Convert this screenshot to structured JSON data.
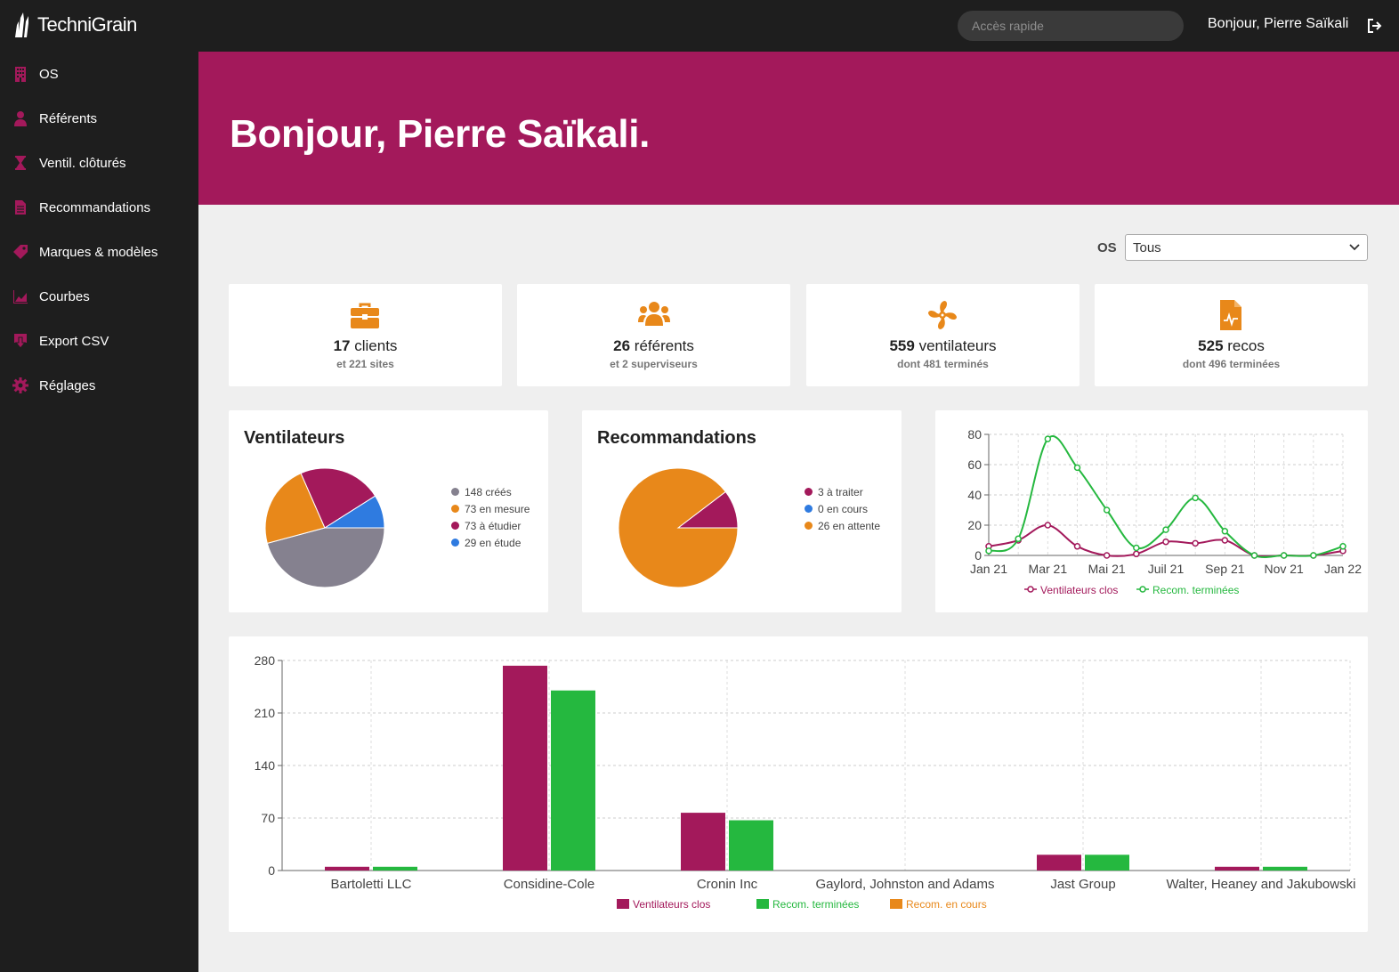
{
  "app": {
    "brand": "TechniGrain",
    "search_placeholder": "Accès rapide",
    "greeting": "Bonjour, Pierre Saïkali",
    "colors": {
      "accent": "#a3195b",
      "icon": "#e8881a",
      "green": "#25b83f",
      "sidebar": "#1e1e1e"
    }
  },
  "sidebar": {
    "items": [
      {
        "label": "OS",
        "icon": "building-icon"
      },
      {
        "label": "Référents",
        "icon": "user-tie-icon"
      },
      {
        "label": "Ventil. clôturés",
        "icon": "hourglass-icon"
      },
      {
        "label": "Recommandations",
        "icon": "document-icon"
      },
      {
        "label": "Marques & modèles",
        "icon": "tag-icon"
      },
      {
        "label": "Courbes",
        "icon": "chart-area-icon"
      },
      {
        "label": "Export CSV",
        "icon": "download-icon"
      },
      {
        "label": "Réglages",
        "icon": "gear-icon"
      }
    ]
  },
  "hero": {
    "title": "Bonjour, Pierre Saïkali."
  },
  "filter": {
    "label": "OS",
    "value": "Tous"
  },
  "stats": [
    {
      "icon": "briefcase-icon",
      "number": "17",
      "label": "clients",
      "sub": "et 221 sites"
    },
    {
      "icon": "users-icon",
      "number": "26",
      "label": "référents",
      "sub": "et 2 superviseurs"
    },
    {
      "icon": "fan-icon",
      "number": "559",
      "label": "ventilateurs",
      "sub": "dont 481 terminés"
    },
    {
      "icon": "file-medical-icon",
      "number": "525",
      "label": "recos",
      "sub": "dont 496 terminées"
    }
  ],
  "chart_data": [
    {
      "type": "pie",
      "title": "Ventilateurs",
      "slices": [
        {
          "label": "148 créés",
          "value": 148,
          "color": "#85818f"
        },
        {
          "label": "73 en mesure",
          "value": 73,
          "color": "#e8881a"
        },
        {
          "label": "73 à étudier",
          "value": 73,
          "color": "#a3195b"
        },
        {
          "label": "29 en étude",
          "value": 29,
          "color": "#2f7be0"
        }
      ]
    },
    {
      "type": "pie",
      "title": "Recommandations",
      "slices": [
        {
          "label": "3 à traiter",
          "value": 3,
          "color": "#a3195b"
        },
        {
          "label": "0 en cours",
          "value": 0,
          "color": "#2f7be0"
        },
        {
          "label": "26 en attente",
          "value": 26,
          "color": "#e8881a"
        }
      ]
    },
    {
      "type": "line",
      "title": "",
      "x": [
        "Jan 21",
        "Feb 21",
        "Mar 21",
        "Apr 21",
        "Mai 21",
        "Jun 21",
        "Juil 21",
        "Aug 21",
        "Sep 21",
        "Oct 21",
        "Nov 21",
        "Dec 21",
        "Jan 22"
      ],
      "x_ticks": [
        "Jan 21",
        "Mar 21",
        "Mai 21",
        "Juil 21",
        "Sep 21",
        "Nov 21",
        "Jan 22"
      ],
      "ylim": [
        0,
        80
      ],
      "y_ticks": [
        0,
        20,
        40,
        60,
        80
      ],
      "series": [
        {
          "name": "Ventilateurs clos",
          "color": "#a3195b",
          "values": [
            6,
            10,
            20,
            6,
            0,
            1,
            9,
            8,
            10,
            0,
            0,
            0,
            3
          ]
        },
        {
          "name": "Recom. terminées",
          "color": "#25b83f",
          "values": [
            3,
            11,
            77,
            58,
            30,
            5,
            17,
            38,
            16,
            0,
            0,
            0,
            6
          ]
        }
      ],
      "grid": true,
      "legend": "bottom"
    },
    {
      "type": "bar",
      "title": "",
      "categories": [
        "Bartoletti LLC",
        "Considine-Cole",
        "Cronin Inc",
        "Gaylord, Johnston and Adams",
        "Jast Group",
        "Walter, Heaney and Jakubowski"
      ],
      "ylim": [
        0,
        280
      ],
      "y_ticks": [
        0,
        70,
        140,
        210,
        280
      ],
      "series": [
        {
          "name": "Ventilateurs clos",
          "color": "#a3195b",
          "values": [
            5,
            273,
            77,
            0,
            21,
            5
          ]
        },
        {
          "name": "Recom. terminées",
          "color": "#25b83f",
          "values": [
            5,
            240,
            67,
            0,
            21,
            5
          ]
        },
        {
          "name": "Recom. en cours",
          "color": "#e8881a",
          "values": [
            0,
            0,
            0,
            0,
            0,
            0
          ]
        }
      ],
      "grid": true,
      "legend": "bottom"
    }
  ]
}
